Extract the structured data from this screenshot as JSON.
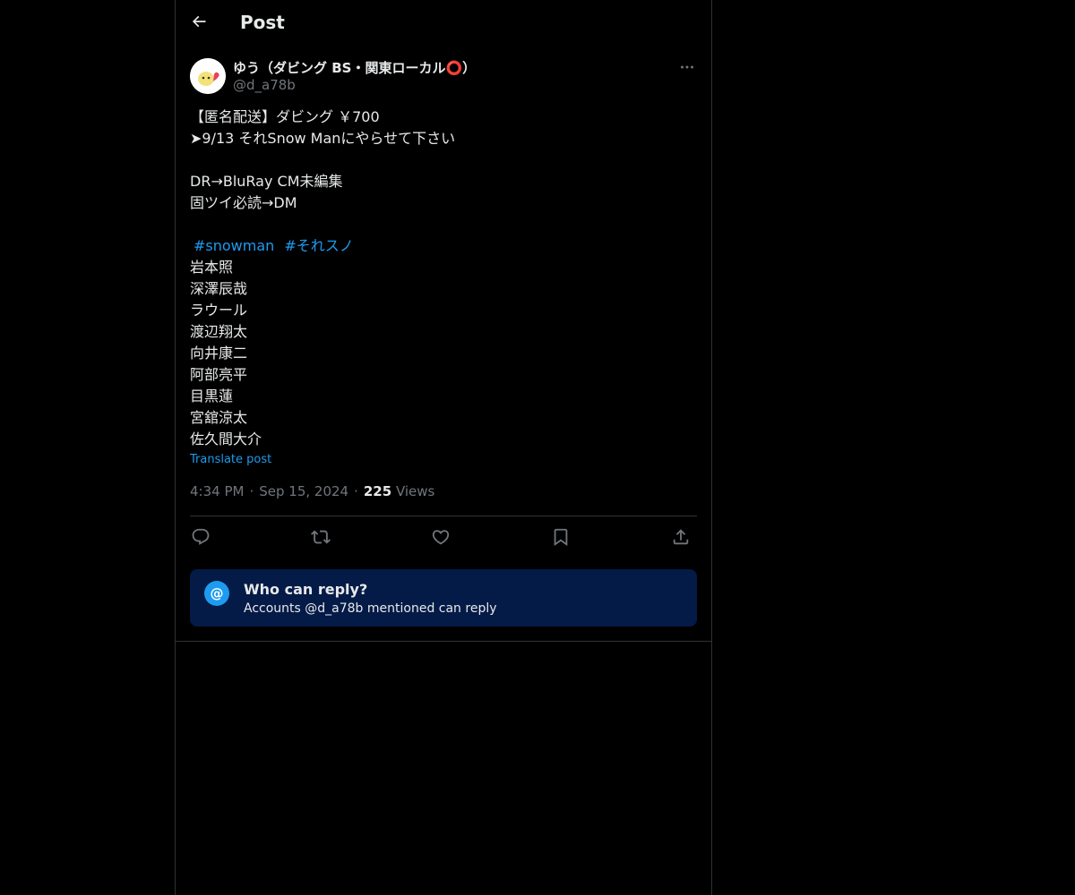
{
  "header": {
    "title": "Post",
    "back_icon": "arrow-left-icon"
  },
  "author": {
    "name": "ゆう（ダビング BS・関東ローカル⭕）",
    "handle": "@d_a78b",
    "more_icon": "more-horizontal-icon"
  },
  "post": {
    "line1": "【匿名配送】ダビング ￥700",
    "line2": "➤9/13 それSnow Manにやらせて下さい",
    "line3": "DR→BluRay CM未編集",
    "line4": "固ツイ必読→DM",
    "hashtag1": "#snowman",
    "hashtag2": "#それスノ",
    "members": [
      "岩本照",
      "深澤辰哉",
      "ラウール",
      "渡辺翔太",
      "向井康二",
      "阿部亮平",
      "目黒蓮",
      "宮舘涼太",
      "佐久間大介"
    ],
    "translate": "Translate post"
  },
  "meta": {
    "time": "4:34 PM",
    "dot": "·",
    "date": "Sep 15, 2024",
    "views_count": "225",
    "views_label": "Views"
  },
  "actions": [
    "reply-icon",
    "repost-icon",
    "like-icon",
    "bookmark-icon",
    "share-icon"
  ],
  "reply_restriction": {
    "icon": "@",
    "title": "Who can reply?",
    "subtitle": "Accounts @d_a78b mentioned can reply"
  },
  "colors": {
    "background": "#000000",
    "accent": "#1d9bf0",
    "secondary_text": "#71767b",
    "border": "#2f3336",
    "reply_box": "#041a47"
  }
}
